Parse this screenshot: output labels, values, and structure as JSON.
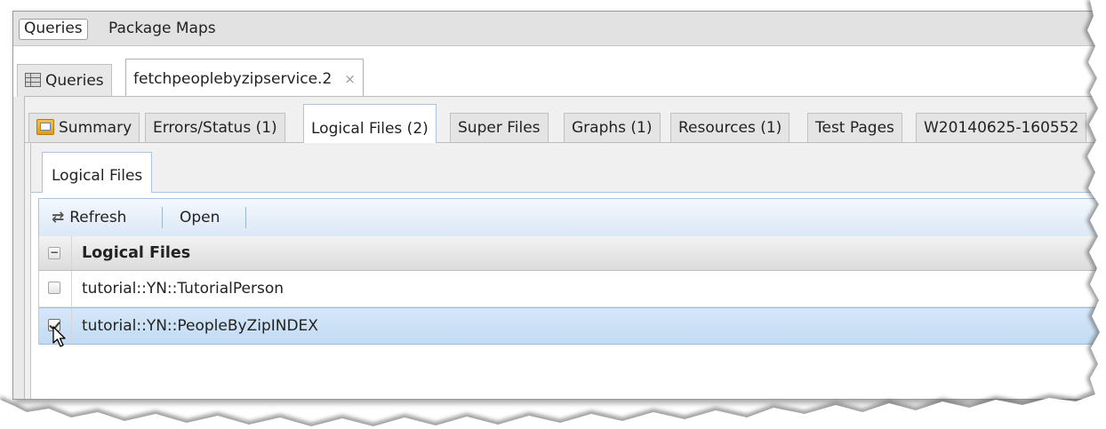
{
  "menu": {
    "items": [
      {
        "label": "Queries",
        "active": true
      },
      {
        "label": "Package Maps",
        "active": false
      }
    ]
  },
  "outer_tabs": [
    {
      "label": "Queries",
      "icon": "grid-icon"
    },
    {
      "label": "fetchpeoplebyzipservice.2",
      "active": true,
      "closable": true,
      "close_glyph": "×"
    }
  ],
  "inner_tabs": [
    {
      "label": "Summary",
      "icon": "summary-icon"
    },
    {
      "label": "Errors/Status (1)"
    },
    {
      "label": "Logical Files (2)",
      "active": true
    },
    {
      "label": "Super Files"
    },
    {
      "label": "Graphs (1)"
    },
    {
      "label": "Resources (1)"
    },
    {
      "label": "Test Pages"
    },
    {
      "label": "W20140625-160552"
    }
  ],
  "subtab": {
    "label": "Logical Files"
  },
  "toolbar": {
    "refresh_label": "Refresh",
    "refresh_glyph": "⇄",
    "open_label": "Open"
  },
  "grid": {
    "header": "Logical Files",
    "header_toggle": "−",
    "rows": [
      {
        "name": "tutorial::YN::TutorialPerson",
        "checked": false
      },
      {
        "name": "tutorial::YN::PeopleByZipINDEX",
        "checked": true,
        "selected": true
      }
    ]
  },
  "colors": {
    "accent": "#a9c4e0",
    "selected_row": "#c8def4"
  }
}
